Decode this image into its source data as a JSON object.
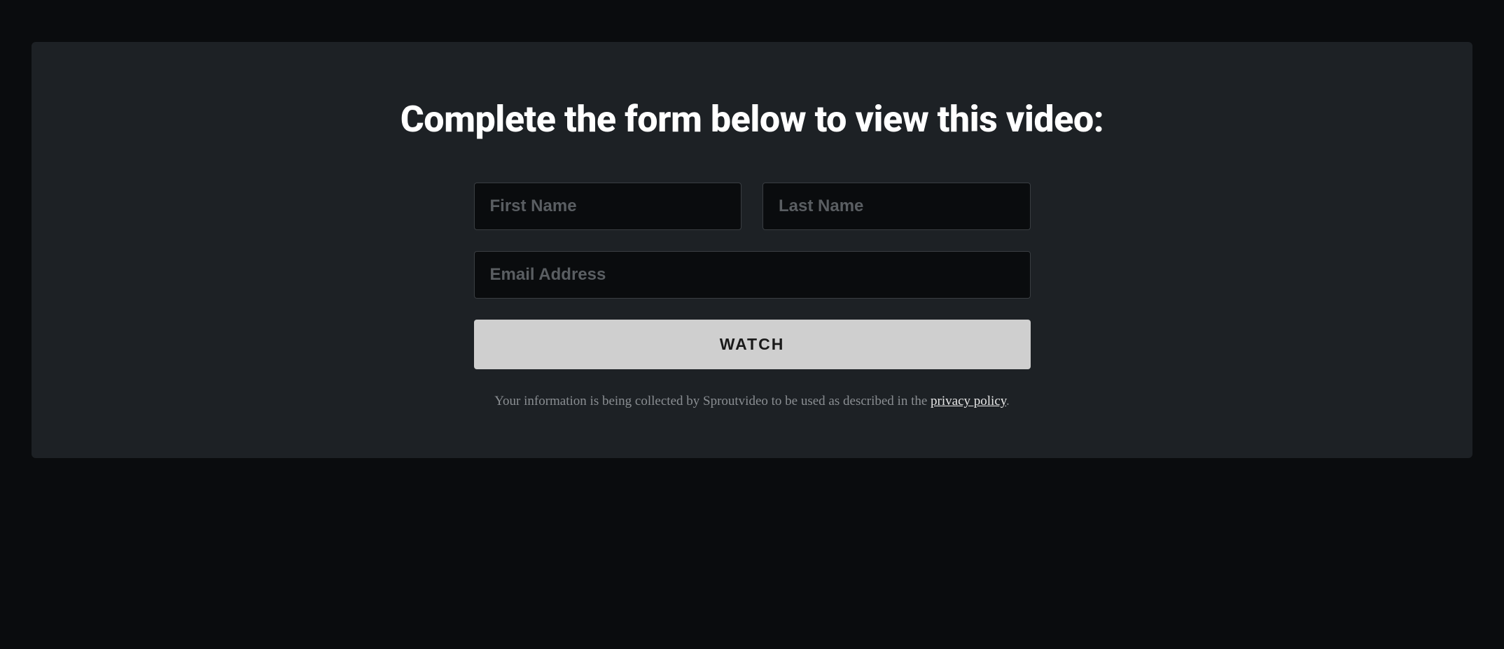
{
  "heading": "Complete the form below to view this video:",
  "form": {
    "first_name_placeholder": "First Name",
    "last_name_placeholder": "Last Name",
    "email_placeholder": "Email Address",
    "submit_label": "WATCH"
  },
  "disclaimer": {
    "text_before": "Your information is being collected by Sproutvideo to be used as described in the ",
    "link_text": "privacy policy",
    "text_after": "."
  }
}
